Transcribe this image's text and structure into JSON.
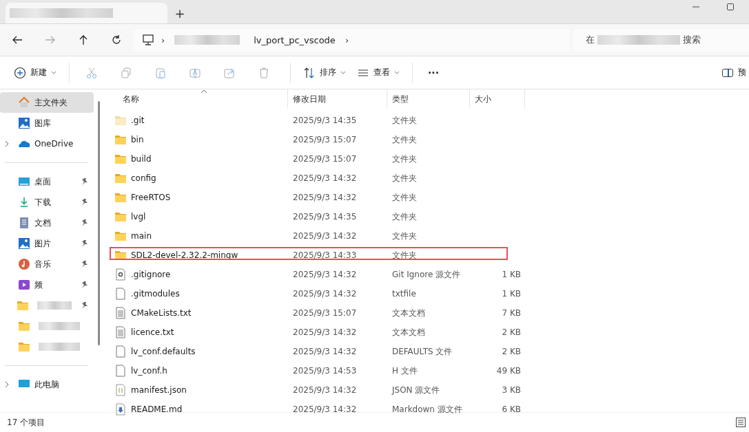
{
  "window": {
    "new_tab": "+"
  },
  "address_bar": {
    "current": "lv_port_pc_vscode",
    "separator": "›",
    "search_prefix": "在",
    "search_suffix": "搜索"
  },
  "toolbar": {
    "new": "新建",
    "sort": "排序",
    "view": "查看",
    "more": "···",
    "preview": "预"
  },
  "sidebar": {
    "items": [
      {
        "label": "主文件夹",
        "kind": "home",
        "selected": true,
        "pinned": false,
        "expandable": false
      },
      {
        "label": "图库",
        "kind": "gallery",
        "selected": false,
        "pinned": false,
        "expandable": false
      },
      {
        "label": "OneDrive",
        "kind": "cloud",
        "selected": false,
        "pinned": false,
        "expandable": true
      },
      {
        "kind": "divider"
      },
      {
        "label": "桌面",
        "kind": "desktop",
        "selected": false,
        "pinned": true,
        "expandable": false
      },
      {
        "label": "下载",
        "kind": "download",
        "selected": false,
        "pinned": true,
        "expandable": false
      },
      {
        "label": "文档",
        "kind": "document",
        "selected": false,
        "pinned": true,
        "expandable": false
      },
      {
        "label": "图片",
        "kind": "gallery",
        "selected": false,
        "pinned": true,
        "expandable": false
      },
      {
        "label": "音乐",
        "kind": "music",
        "selected": false,
        "pinned": true,
        "expandable": false
      },
      {
        "label": "频",
        "kind": "video",
        "selected": false,
        "pinned": true,
        "expandable": false
      },
      {
        "kind": "folder",
        "selected": false,
        "pinned": true,
        "expandable": false
      },
      {
        "kind": "folder",
        "selected": false,
        "pinned": false,
        "expandable": false
      },
      {
        "kind": "folder",
        "selected": false,
        "pinned": false,
        "expandable": false
      },
      {
        "kind": "divider"
      },
      {
        "label": "此电脑",
        "kind": "pc",
        "selected": false,
        "pinned": false,
        "expandable": true
      }
    ]
  },
  "table": {
    "columns": [
      "名称",
      "修改日期",
      "类型",
      "大小"
    ],
    "rows": [
      {
        "name": ".git",
        "kind": "folder-hidden",
        "modified": "2025/9/3 14:35",
        "type": "文件夹",
        "highlighted": false
      },
      {
        "name": "bin",
        "kind": "folder",
        "modified": "2025/9/3 15:07",
        "type": "文件夹",
        "highlighted": false
      },
      {
        "name": "build",
        "kind": "folder",
        "modified": "2025/9/3 15:07",
        "type": "文件夹",
        "highlighted": false
      },
      {
        "name": "config",
        "kind": "folder",
        "modified": "2025/9/3 14:32",
        "type": "文件夹",
        "highlighted": false
      },
      {
        "name": "FreeRTOS",
        "kind": "folder",
        "modified": "2025/9/3 14:32",
        "type": "文件夹",
        "highlighted": false
      },
      {
        "name": "lvgl",
        "kind": "folder",
        "modified": "2025/9/3 14:35",
        "type": "文件夹",
        "highlighted": false
      },
      {
        "name": "main",
        "kind": "folder",
        "modified": "2025/9/3 14:32",
        "type": "文件夹",
        "highlighted": false
      },
      {
        "name": "SDL2-devel-2.32.2-mingw",
        "kind": "folder",
        "modified": "2025/9/3 14:33",
        "type": "文件夹",
        "highlighted": true
      },
      {
        "name": ".gitignore",
        "kind": "settings-file",
        "modified": "2025/9/3 14:32",
        "type": "Git Ignore 源文件",
        "size": "1 KB",
        "highlighted": false
      },
      {
        "name": ".gitmodules",
        "kind": "file",
        "modified": "2025/9/3 14:32",
        "type": "txtfile",
        "size": "1 KB",
        "highlighted": false
      },
      {
        "name": "CMakeLists.txt",
        "kind": "text-file",
        "modified": "2025/9/3 15:07",
        "type": "文本文档",
        "size": "7 KB",
        "highlighted": false
      },
      {
        "name": "licence.txt",
        "kind": "text-file",
        "modified": "2025/9/3 14:32",
        "type": "文本文档",
        "size": "2 KB",
        "highlighted": false
      },
      {
        "name": "lv_conf.defaults",
        "kind": "file",
        "modified": "2025/9/3 14:32",
        "type": "DEFAULTS 文件",
        "size": "2 KB",
        "highlighted": false
      },
      {
        "name": "lv_conf.h",
        "kind": "file",
        "modified": "2025/9/3 14:53",
        "type": "H 文件",
        "size": "49 KB",
        "highlighted": false
      },
      {
        "name": "manifest.json",
        "kind": "json-file",
        "modified": "2025/9/3 14:32",
        "type": "JSON 源文件",
        "size": "3 KB",
        "highlighted": false
      },
      {
        "name": "README.md",
        "kind": "markdown-file",
        "modified": "2025/9/3 14:32",
        "type": "Markdown 源文件",
        "size": "6 KB",
        "highlighted": false
      }
    ]
  },
  "status_bar": {
    "count": "17 个项目"
  }
}
